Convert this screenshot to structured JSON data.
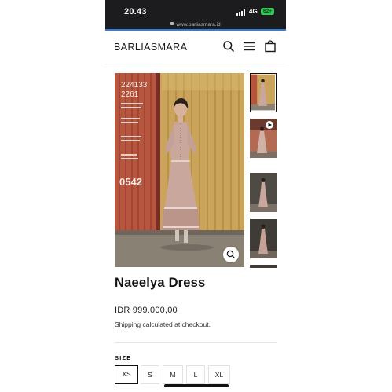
{
  "status_bar": {
    "time": "20.43",
    "network": "4G",
    "battery": "62+"
  },
  "browser": {
    "url": "www.barliasmara.id"
  },
  "header": {
    "brand": "BARLIASMARA"
  },
  "icons": {
    "search": "search-icon",
    "menu": "hamburger-menu-icon",
    "cart": "shopping-bag-icon",
    "zoom": "zoom-in-icon",
    "play": "play-icon",
    "lock": "lock-icon"
  },
  "gallery": {
    "container_text": [
      "224133",
      "2261"
    ],
    "container_number": "0542",
    "thumbnails": [
      "Front view",
      "Video",
      "Side view",
      "Back view"
    ]
  },
  "product": {
    "title": "Naeelya Dress",
    "price": "IDR 999.000,00",
    "shipping_link": "Shipping",
    "shipping_rest": "calculated at checkout."
  },
  "sizes": {
    "label": "SIZE",
    "options": [
      "XS",
      "S",
      "M",
      "L",
      "XL"
    ],
    "selected": "XS"
  },
  "colors": {
    "accent": "#2f7de1",
    "battery": "#34c759",
    "container": "#b8553f",
    "wall": "#c9a45a"
  }
}
